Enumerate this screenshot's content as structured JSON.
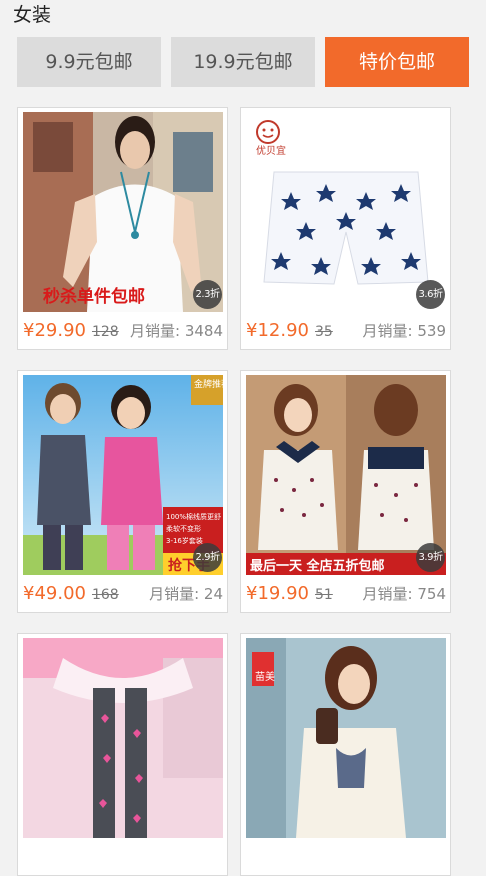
{
  "header": {
    "title": "女装"
  },
  "filters": [
    {
      "label": "9.9元包邮"
    },
    {
      "label": "19.9元包邮"
    },
    {
      "label": "特价包邮"
    }
  ],
  "accent_color": "#f26a2b",
  "products": [
    {
      "price": "¥29.90",
      "original_price": "128",
      "sales": "月销量: 3484",
      "discount": "2.3折",
      "image_text": "秒杀单件包邮"
    },
    {
      "price": "¥12.90",
      "original_price": "35",
      "sales": "月销量: 539",
      "discount": "3.6折",
      "brand": "优贝宜"
    },
    {
      "price": "¥49.00",
      "original_price": "168",
      "sales": "月销量: 24",
      "discount": "2.9折",
      "badge": "金牌推荐",
      "promo_lines": [
        "100%棉线质更舒",
        "柔软不变形",
        "3-16岁套装"
      ],
      "cta": "抢下手"
    },
    {
      "price": "¥19.90",
      "original_price": "51",
      "sales": "月销量: 754",
      "discount": "3.9折",
      "image_text": "最后一天 全店五折包邮"
    },
    {},
    {
      "brand": "苗美"
    }
  ]
}
